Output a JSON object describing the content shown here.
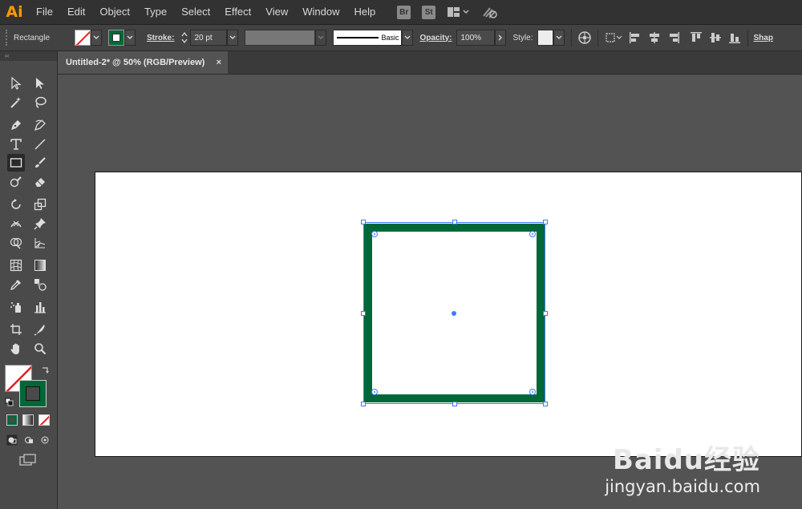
{
  "app": {
    "logo": "Ai"
  },
  "menu": [
    "File",
    "Edit",
    "Object",
    "Type",
    "Select",
    "Effect",
    "View",
    "Window",
    "Help"
  ],
  "menubar_icons": {
    "bridge": "Br",
    "stock": "St"
  },
  "control": {
    "object_type": "Rectangle",
    "stroke_label": "Stroke:",
    "stroke_weight": "20 pt",
    "brush_label": "Basic",
    "opacity_label": "Opacity:",
    "opacity_value": "100%",
    "style_label": "Style:",
    "shape_label": "Shap"
  },
  "document": {
    "tab_title": "Untitled-2* @ 50% (RGB/Preview)",
    "close_glyph": "×"
  },
  "colors": {
    "stroke": "#006838",
    "selection": "#3d7bff",
    "accent": "#ff9a00"
  },
  "watermark": {
    "brand": "Baidu经验",
    "url": "jingyan.baidu.com"
  }
}
